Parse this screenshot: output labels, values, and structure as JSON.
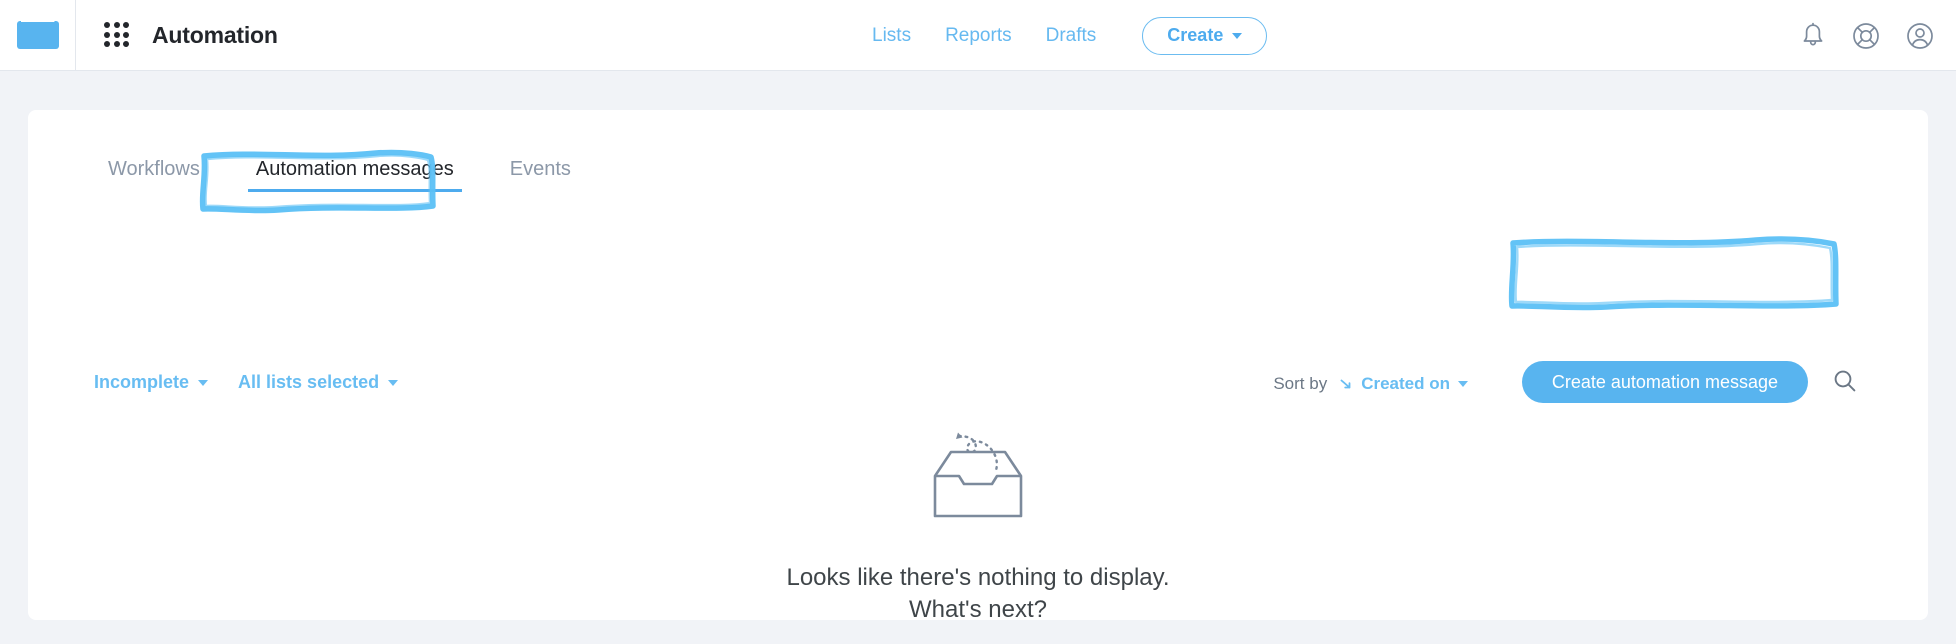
{
  "topbar": {
    "logo_icon": "envelope-logo-icon",
    "app_switcher_icon": "app-grid-icon",
    "brand_title": "Automation",
    "nav": [
      {
        "label": "Lists",
        "name": "lists"
      },
      {
        "label": "Reports",
        "name": "reports"
      },
      {
        "label": "Drafts",
        "name": "drafts"
      }
    ],
    "create_label": "Create",
    "icons": [
      {
        "name": "bell-icon"
      },
      {
        "name": "lifebuoy-icon"
      },
      {
        "name": "account-icon"
      }
    ]
  },
  "tabs": [
    {
      "label": "Workflows",
      "name": "workflows",
      "active": false
    },
    {
      "label": "Automation messages",
      "name": "automation-messages",
      "active": true
    },
    {
      "label": "Events",
      "name": "events",
      "active": false
    }
  ],
  "toolbar": {
    "status_filter": "Incomplete",
    "list_filter": "All lists selected",
    "sort_by_label": "Sort by",
    "sort_value": "Created on",
    "sort_direction_icon": "arrow-descending-icon",
    "create_message_label": "Create automation message",
    "search_icon": "search-icon"
  },
  "empty_state": {
    "illustration": "empty-inbox-tray-icon",
    "line1": "Looks like there's nothing to display.",
    "line2": "What's next?"
  },
  "colors": {
    "accent_blue": "#58b4ef",
    "link_blue": "#68bdf2",
    "annotation_blue": "#5bc0f5",
    "page_bg": "#f1f3f7",
    "card_bg": "#ffffff",
    "text_dark": "#23262b",
    "text_muted": "#8c98a8",
    "icon_slate": "#7c8a9c"
  },
  "annotations": [
    {
      "name": "annotation-automation-messages-tab"
    },
    {
      "name": "annotation-create-automation-message-button"
    }
  ]
}
